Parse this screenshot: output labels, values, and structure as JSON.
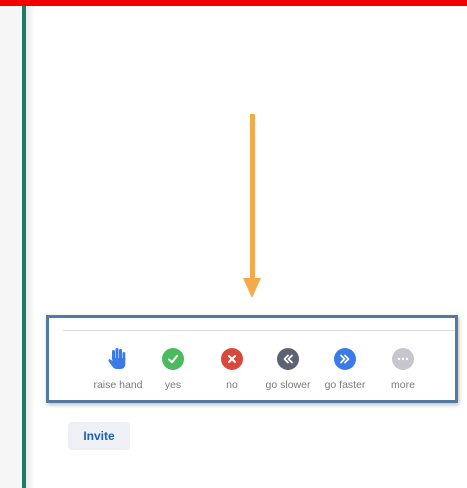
{
  "reactions": [
    {
      "label": "raise hand",
      "icon": "raise-hand-icon",
      "color": "#3a7be8"
    },
    {
      "label": "yes",
      "icon": "checkmark-icon",
      "color": "#4cbb5e"
    },
    {
      "label": "no",
      "icon": "x-icon",
      "color": "#d9493b"
    },
    {
      "label": "go slower",
      "icon": "double-chevron-left-icon",
      "color": "#5f6270"
    },
    {
      "label": "go faster",
      "icon": "double-chevron-right-icon",
      "color": "#3a7be8"
    },
    {
      "label": "more",
      "icon": "ellipsis-icon",
      "color": "#c6c6cc"
    }
  ],
  "invite": {
    "label": "Invite"
  },
  "colors": {
    "top_bar": "#f20000",
    "left_rule": "#1f7b66",
    "arrow": "#f5a94a",
    "panel_border": "#537aa1",
    "invite_text": "#1f5fbf"
  }
}
